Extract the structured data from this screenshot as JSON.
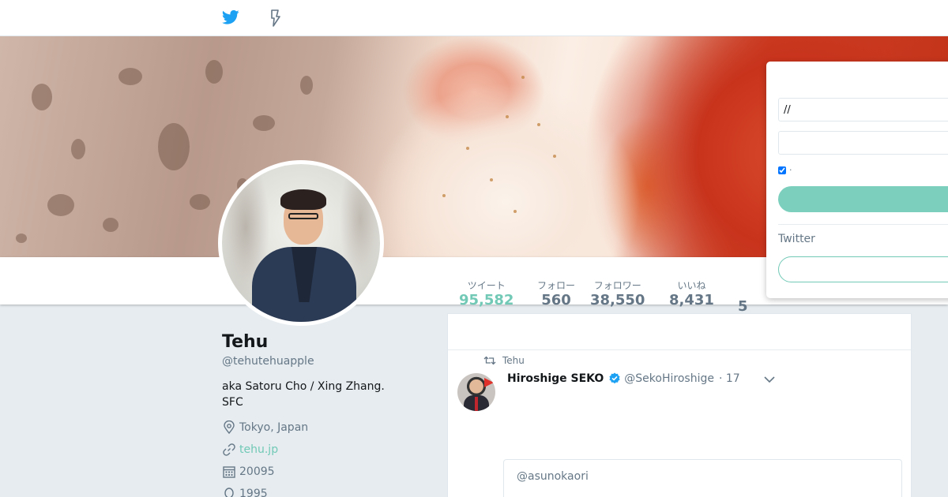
{
  "nav": {
    "home_icon": "twitter-bird-icon",
    "moments_icon": "lightning-icon"
  },
  "profile": {
    "name": "Tehu",
    "handle": "@tehutehuapple",
    "bio": "aka Satoru Cho / Xing Zhang. SFC",
    "location": "Tokyo, Japan",
    "url": "tehu.jp",
    "joined": "20095",
    "birth": "1995"
  },
  "stats": [
    {
      "label": "ツイート",
      "value": "95,582"
    },
    {
      "label": "フォロー",
      "value": "560"
    },
    {
      "label": "フォロワー",
      "value": "38,550"
    },
    {
      "label": "いいね",
      "value": "8,431"
    }
  ],
  "stats_extra": "5",
  "timeline": {
    "retweet_context": "Tehu",
    "tweet": {
      "author_name": "Hiroshige SEKO",
      "author_handle": "@SekoHiroshige",
      "time": "· 17",
      "quote_text": "@asunokaori"
    }
  },
  "login": {
    "username_value": "//",
    "password_value": "",
    "remember_label": "·",
    "twitter_label": "Twitter",
    "login_button": "",
    "signup_button": ""
  },
  "colors": {
    "accent": "#71c9b6",
    "verified": "#1da1f2",
    "twitter_blue": "#1da1f2"
  }
}
